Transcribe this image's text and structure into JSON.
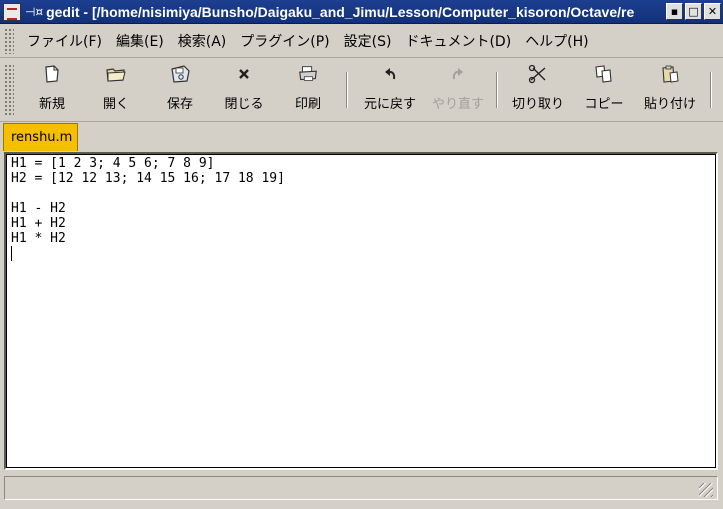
{
  "window": {
    "title": "gedit - [/home/nisimiya/Bunsho/Daigaku_and_Jimu/Lesson/Computer_kisoron/Octave/re",
    "pin_icon": "pin-icon",
    "buttons": {
      "minimize": "▪",
      "maximize": "□",
      "close": "✕"
    }
  },
  "menubar": {
    "items": [
      {
        "label": "ファイル(F)"
      },
      {
        "label": "編集(E)"
      },
      {
        "label": "検索(A)"
      },
      {
        "label": "プラグイン(P)"
      },
      {
        "label": "設定(S)"
      },
      {
        "label": "ドキュメント(D)"
      },
      {
        "label": "ヘルプ(H)"
      }
    ]
  },
  "toolbar": {
    "new": {
      "label": "新規",
      "icon": "new-document-icon"
    },
    "open": {
      "label": "開く",
      "icon": "open-folder-icon"
    },
    "save": {
      "label": "保存",
      "icon": "save-disk-icon"
    },
    "close": {
      "label": "閉じる",
      "icon": "close-x-icon"
    },
    "print": {
      "label": "印刷",
      "icon": "printer-icon"
    },
    "undo": {
      "label": "元に戻す",
      "icon": "undo-arrow-icon"
    },
    "redo": {
      "label": "やり直す",
      "icon": "redo-arrow-icon",
      "disabled": true
    },
    "cut": {
      "label": "切り取り",
      "icon": "scissors-icon"
    },
    "copy": {
      "label": "コピー",
      "icon": "copy-icon"
    },
    "paste": {
      "label": "貼り付け",
      "icon": "paste-clipboard-icon"
    }
  },
  "tabs": [
    {
      "label": "renshu.m",
      "active": true,
      "color": "#f5be00"
    }
  ],
  "editor": {
    "lines": [
      "H1 = [1 2 3; 4 5 6; 7 8 9]",
      "H2 = [12 12 13; 14 15 16; 17 18 19]",
      "",
      "H1 - H2",
      "H1 + H2",
      "H1 * H2",
      ""
    ]
  },
  "statusbar": {
    "text": ""
  }
}
